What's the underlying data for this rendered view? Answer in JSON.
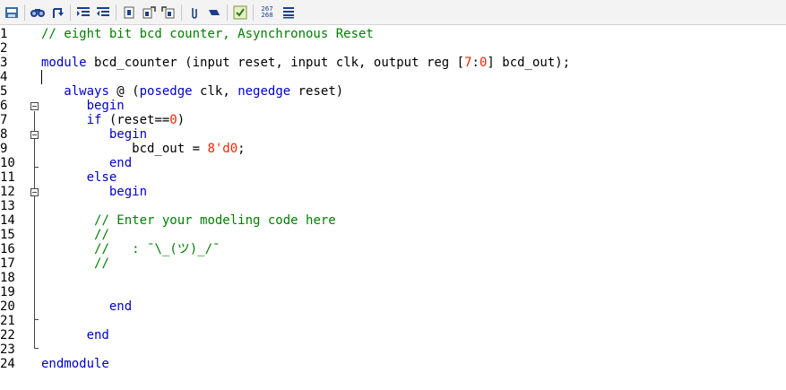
{
  "toolbar": {
    "icons": [
      "save-project-icon",
      "find-icon",
      "goto-icon",
      "indent-icon",
      "outdent-icon",
      "bookmark-icon",
      "next-bookmark-icon",
      "prev-bookmark-icon",
      "attach-icon",
      "eraser-icon",
      "check-syntax-icon",
      "line-numbers-icon",
      "list-icon"
    ],
    "line_numbers_label_top": "267",
    "line_numbers_label_bottom": "268"
  },
  "editor": {
    "line_numbers": [
      "1",
      "2",
      "3",
      "4",
      "5",
      "6",
      "7",
      "8",
      "9",
      "10",
      "11",
      "12",
      "13",
      "14",
      "15",
      "16",
      "17",
      "18",
      "19",
      "20",
      "21",
      "22",
      "23",
      "24"
    ],
    "lines": [
      [
        {
          "t": "// eight bit bcd counter, Asynchronous Reset",
          "c": "cm"
        }
      ],
      [],
      [
        {
          "t": "module",
          "c": "kw"
        },
        {
          "t": " bcd_counter (",
          "c": ""
        },
        {
          "t": "input",
          "c": ""
        },
        {
          "t": " reset, ",
          "c": ""
        },
        {
          "t": "input",
          "c": ""
        },
        {
          "t": " clk, ",
          "c": ""
        },
        {
          "t": "output",
          "c": ""
        },
        {
          "t": " ",
          "c": ""
        },
        {
          "t": "reg",
          "c": ""
        },
        {
          "t": " [",
          "c": ""
        },
        {
          "t": "7",
          "c": "nm"
        },
        {
          "t": ":",
          "c": ""
        },
        {
          "t": "0",
          "c": "nm"
        },
        {
          "t": "] bcd_out);",
          "c": ""
        }
      ],
      [],
      [
        {
          "t": "   ",
          "c": ""
        },
        {
          "t": "always",
          "c": "kw"
        },
        {
          "t": " @ (",
          "c": ""
        },
        {
          "t": "posedge",
          "c": "kw"
        },
        {
          "t": " clk, ",
          "c": ""
        },
        {
          "t": "negedge",
          "c": "kw"
        },
        {
          "t": " reset)",
          "c": ""
        }
      ],
      [
        {
          "t": "      ",
          "c": ""
        },
        {
          "t": "begin",
          "c": "kw"
        }
      ],
      [
        {
          "t": "      ",
          "c": ""
        },
        {
          "t": "if",
          "c": "kw"
        },
        {
          "t": " (reset==",
          "c": ""
        },
        {
          "t": "0",
          "c": "nm"
        },
        {
          "t": ")",
          "c": ""
        }
      ],
      [
        {
          "t": "         ",
          "c": ""
        },
        {
          "t": "begin",
          "c": "kw"
        }
      ],
      [
        {
          "t": "            bcd_out = ",
          "c": ""
        },
        {
          "t": "8'd0",
          "c": "nm"
        },
        {
          "t": ";",
          "c": ""
        }
      ],
      [
        {
          "t": "         ",
          "c": ""
        },
        {
          "t": "end",
          "c": "kw"
        }
      ],
      [
        {
          "t": "      ",
          "c": ""
        },
        {
          "t": "else",
          "c": "kw"
        }
      ],
      [
        {
          "t": "         ",
          "c": ""
        },
        {
          "t": "begin",
          "c": "kw"
        }
      ],
      [],
      [
        {
          "t": "       ",
          "c": ""
        },
        {
          "t": "// Enter your modeling code here",
          "c": "cm"
        }
      ],
      [
        {
          "t": "       ",
          "c": ""
        },
        {
          "t": "//",
          "c": "cm"
        }
      ],
      [
        {
          "t": "       ",
          "c": ""
        },
        {
          "t": "//   : ¯\\_(ツ)_/¯",
          "c": "cm"
        }
      ],
      [
        {
          "t": "       ",
          "c": ""
        },
        {
          "t": "//",
          "c": "cm"
        }
      ],
      [],
      [],
      [
        {
          "t": "         ",
          "c": ""
        },
        {
          "t": "end",
          "c": "kw"
        }
      ],
      [],
      [
        {
          "t": "      ",
          "c": ""
        },
        {
          "t": "end",
          "c": "kw"
        }
      ],
      [],
      [
        {
          "t": "endmodule",
          "c": "kw"
        }
      ]
    ]
  },
  "colors": {
    "keyword": "#0000cc",
    "comment": "#008000",
    "number": "#ff2200",
    "text": "#000000"
  }
}
